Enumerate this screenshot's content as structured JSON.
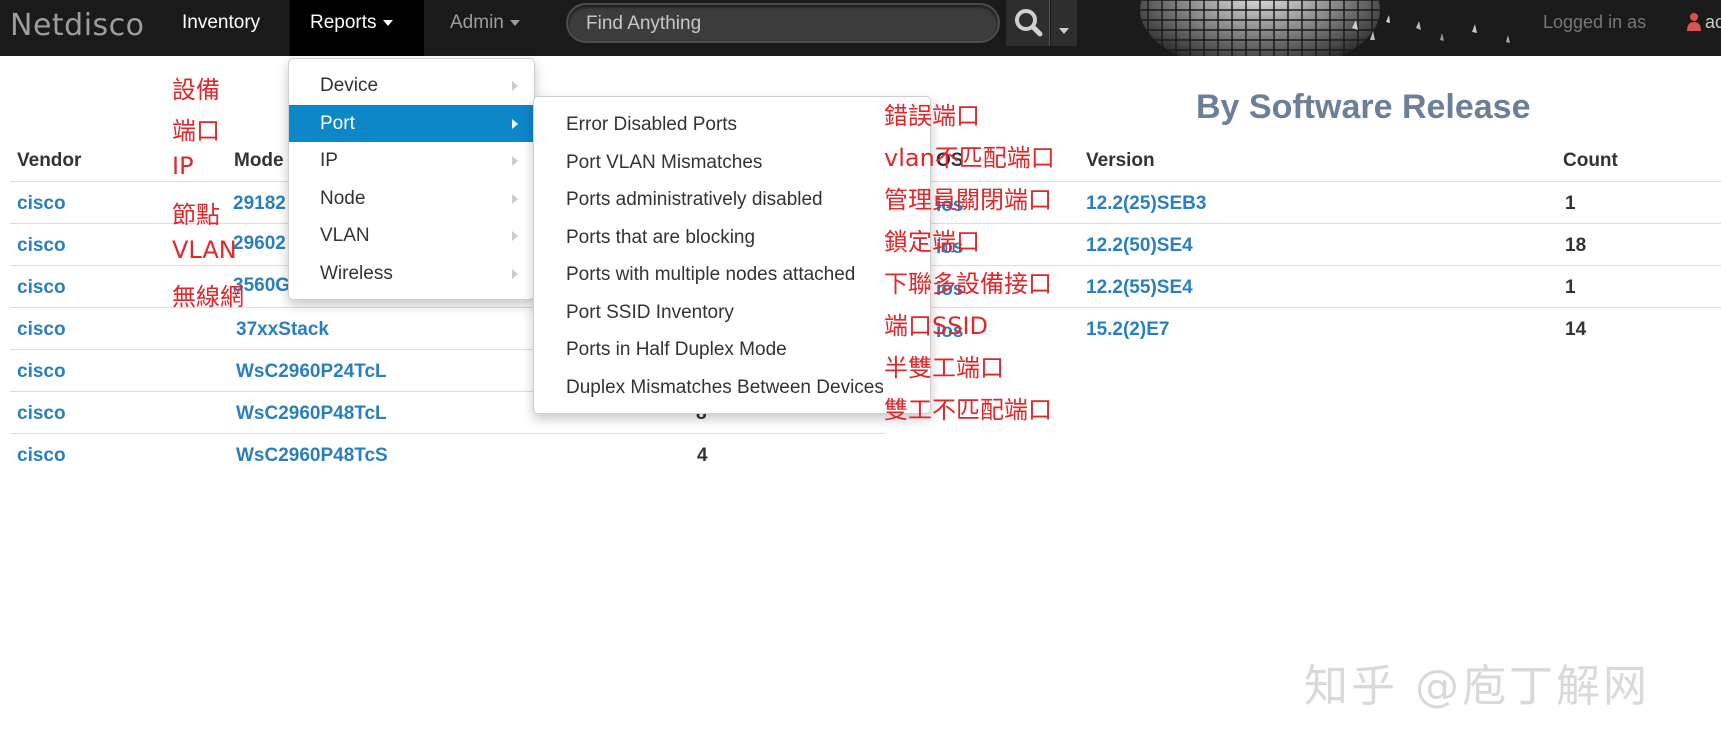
{
  "navbar": {
    "brand": "Netdisco",
    "inventory": "Inventory",
    "reports": "Reports",
    "admin": "Admin",
    "search_placeholder": "Find Anything",
    "logged_in": "Logged in as",
    "user_fragment": "ac",
    "icons": [
      "search-icon",
      "caret-down-icon",
      "user-icon",
      "disco-ball-icon"
    ]
  },
  "models_table": {
    "headers": {
      "vendor": "Vendor",
      "model": "Mode"
    },
    "rows": [
      {
        "vendor": "cisco",
        "model": "29182",
        "count": ""
      },
      {
        "vendor": "cisco",
        "model": "29602",
        "count": ""
      },
      {
        "vendor": "cisco",
        "model": "3560G",
        "count": ""
      },
      {
        "vendor": "cisco",
        "model": "37xxStack",
        "count": ""
      },
      {
        "vendor": "cisco",
        "model": "WsC2960P24TcL",
        "count": ""
      },
      {
        "vendor": "cisco",
        "model": "WsC2960P48TcL",
        "count": "8"
      },
      {
        "vendor": "cisco",
        "model": "WsC2960P48TcS",
        "count": "4"
      }
    ]
  },
  "release_table": {
    "title": "By Software Release",
    "headers": {
      "os": "OS",
      "version": "Version",
      "count": "Count"
    },
    "rows": [
      {
        "os": "ios",
        "version": "12.2(25)SEB3",
        "count": "1"
      },
      {
        "os": "ios",
        "version": "12.2(50)SE4",
        "count": "18"
      },
      {
        "os": "ios",
        "version": "12.2(55)SE4",
        "count": "1"
      },
      {
        "os": "ios",
        "version": "15.2(2)E7",
        "count": "14"
      }
    ]
  },
  "reports_menu": {
    "items": [
      "Device",
      "Port",
      "IP",
      "Node",
      "VLAN",
      "Wireless"
    ],
    "active": "Port"
  },
  "port_submenu": {
    "items": [
      "Error Disabled Ports",
      "Port VLAN Mismatches",
      "Ports administratively disabled",
      "Ports that are blocking",
      "Ports with multiple nodes attached",
      "Port SSID Inventory",
      "Ports in Half Duplex Mode",
      "Duplex Mismatches Between Devices"
    ]
  },
  "annotations": {
    "left": [
      "設備",
      "端口",
      "IP",
      "節點",
      "VLAN",
      "無線網"
    ],
    "right": [
      "錯誤端口",
      "vlan不匹配端口",
      "管理員關閉端口",
      "鎖定端口",
      "下聯多設備接口",
      "端口SSID",
      "半雙工端口",
      "雙工不匹配端口"
    ]
  },
  "watermark": "知乎 @庖丁解网",
  "colors": {
    "navbar_bg": "#1a1a1a",
    "active_menu": "#0e87c9",
    "link": "#2a7fc2",
    "annotation": "#e2262a",
    "title": "#6b7f99"
  }
}
